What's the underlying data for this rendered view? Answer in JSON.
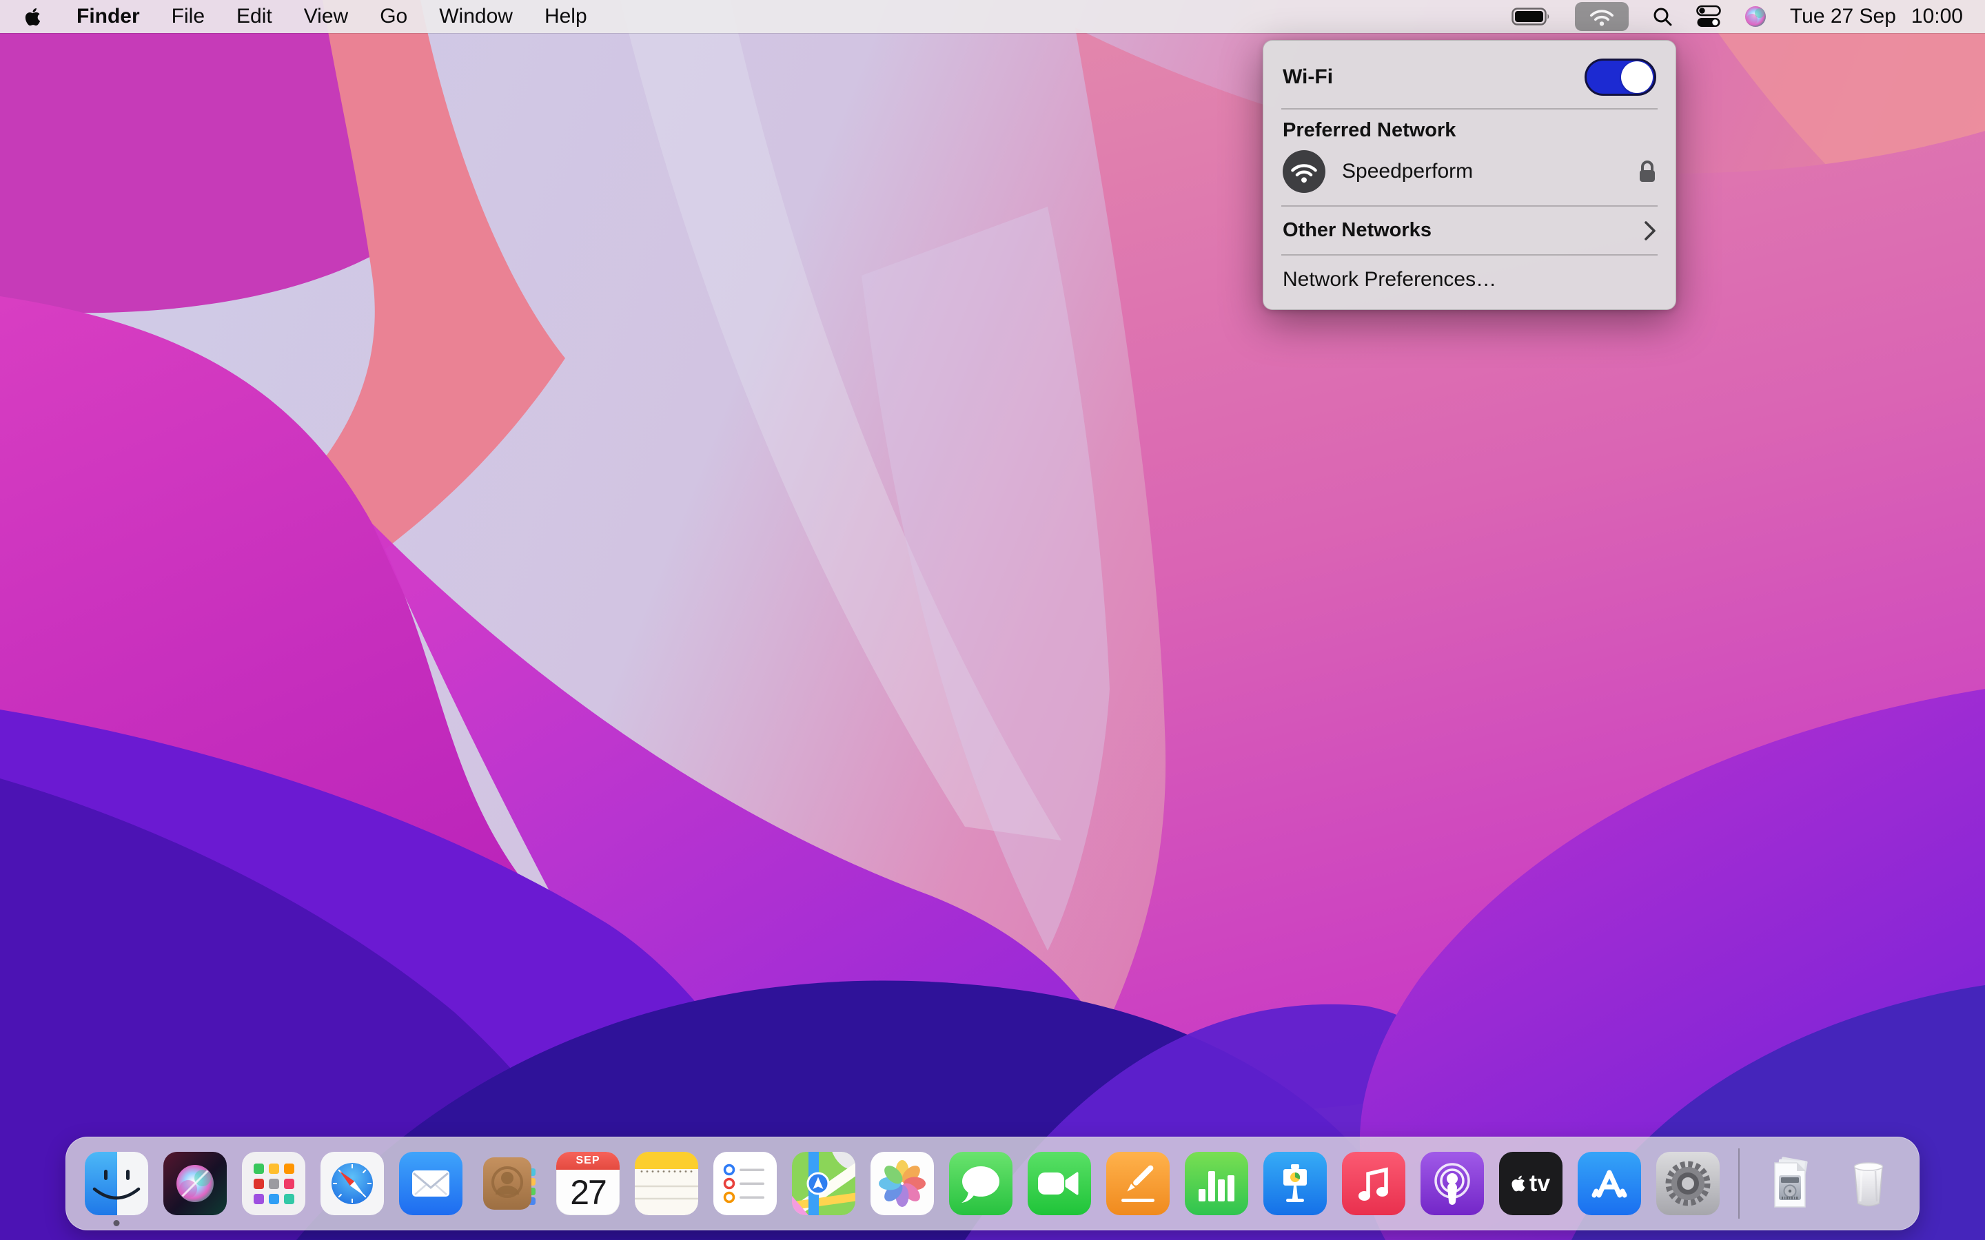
{
  "menu_bar": {
    "items": [
      "Finder",
      "File",
      "Edit",
      "View",
      "Go",
      "Window",
      "Help"
    ],
    "active_app": "Finder",
    "status_icons": [
      "battery-icon",
      "wifi-icon",
      "spotlight-icon",
      "control-center-icon",
      "siri-icon"
    ],
    "clock": {
      "date": "Tue 27 Sep",
      "time": "10:00"
    }
  },
  "wifi_menu": {
    "title": "Wi-Fi",
    "toggle_on": true,
    "accent_blue": "#1c2ad2",
    "preferred_section_label": "Preferred Network",
    "network": {
      "name": "Speedperform",
      "icon": "wifi-circle-icon",
      "secured": true,
      "secured_icon": "lock-icon"
    },
    "other_networks_label": "Other Networks",
    "chevron_icon": "chevron-right-icon",
    "preferences_label": "Network Preferences…"
  },
  "dock": {
    "items": [
      "finder",
      "siri",
      "launchpad",
      "safari",
      "mail",
      "contacts",
      "calendar",
      "notes",
      "reminders",
      "maps",
      "photos",
      "messages",
      "facetime",
      "pages",
      "numbers",
      "keynote",
      "music",
      "podcasts",
      "tv",
      "app-store",
      "system-preferences",
      "documents-stack",
      "trash"
    ],
    "running_app": "finder",
    "calendar": {
      "month": "SEP",
      "day": "27"
    },
    "tv_label": "tv"
  },
  "wallpaper": {
    "name": "macOS Monterey abstract waves",
    "colors": {
      "lavender": "#cfcde8",
      "salmon": "#ea8495",
      "magenta": "#c93bb8",
      "rose": "#da64b4",
      "violet": "#6b1ad2",
      "indigo": "#2f1299",
      "purple": "#a826d6"
    }
  }
}
